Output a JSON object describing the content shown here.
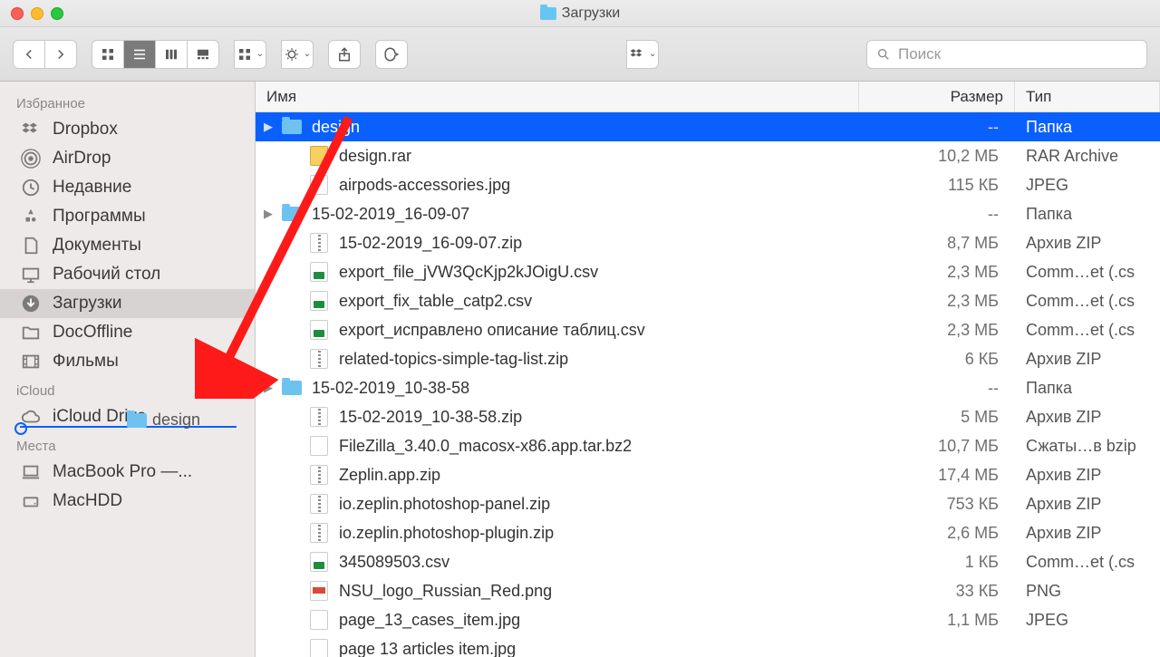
{
  "window": {
    "title": "Загрузки"
  },
  "toolbar": {
    "search_placeholder": "Поиск"
  },
  "sidebar": {
    "sections": [
      {
        "title": "Избранное",
        "items": [
          {
            "icon": "dropbox",
            "label": "Dropbox"
          },
          {
            "icon": "airdrop",
            "label": "AirDrop"
          },
          {
            "icon": "recent",
            "label": "Недавние"
          },
          {
            "icon": "apps",
            "label": "Программы"
          },
          {
            "icon": "documents",
            "label": "Документы"
          },
          {
            "icon": "desktop",
            "label": "Рабочий стол"
          },
          {
            "icon": "downloads",
            "label": "Загрузки",
            "active": true
          },
          {
            "icon": "folder",
            "label": "DocOffline"
          },
          {
            "icon": "movies",
            "label": "Фильмы"
          }
        ]
      },
      {
        "title": "iCloud",
        "items": [
          {
            "icon": "icloud",
            "label": "iCloud Drive"
          }
        ]
      },
      {
        "title": "Места",
        "items": [
          {
            "icon": "laptop",
            "label": "MacBook Pro —..."
          },
          {
            "icon": "disk",
            "label": "MacHDD"
          }
        ]
      }
    ],
    "drag_label": "design"
  },
  "columns": {
    "name": "Имя",
    "size": "Размер",
    "type": "Тип"
  },
  "files": [
    {
      "expand": "▶",
      "icon": "folder",
      "name": "design",
      "size": "--",
      "type": "Папка",
      "selected": true
    },
    {
      "indent": 1,
      "icon": "rar",
      "name": "design.rar",
      "size": "10,2 МБ",
      "type": "RAR Archive"
    },
    {
      "indent": 1,
      "icon": "jpg",
      "name": "airpods-accessories.jpg",
      "size": "115 КБ",
      "type": "JPEG"
    },
    {
      "expand": "▶",
      "icon": "folder",
      "name": "15-02-2019_16-09-07",
      "size": "--",
      "type": "Папка"
    },
    {
      "indent": 1,
      "icon": "zip",
      "name": "15-02-2019_16-09-07.zip",
      "size": "8,7 МБ",
      "type": "Архив ZIP"
    },
    {
      "indent": 1,
      "icon": "csv",
      "name": "export_file_jVW3QcKjp2kJOigU.csv",
      "size": "2,3 МБ",
      "type": "Comm…et (.cs"
    },
    {
      "indent": 1,
      "icon": "csv",
      "name": "export_fix_table_catp2.csv",
      "size": "2,3 МБ",
      "type": "Comm…et (.cs"
    },
    {
      "indent": 1,
      "icon": "csv",
      "name": "export_исправлено описание таблиц.csv",
      "size": "2,3 МБ",
      "type": "Comm…et (.cs"
    },
    {
      "indent": 1,
      "icon": "zip",
      "name": "related-topics-simple-tag-list.zip",
      "size": "6 КБ",
      "type": "Архив ZIP"
    },
    {
      "expand": "▶",
      "icon": "folder",
      "name": "15-02-2019_10-38-58",
      "size": "--",
      "type": "Папка"
    },
    {
      "indent": 1,
      "icon": "zip",
      "name": "15-02-2019_10-38-58.zip",
      "size": "5 МБ",
      "type": "Архив ZIP"
    },
    {
      "indent": 1,
      "icon": "bz2",
      "name": "FileZilla_3.40.0_macosx-x86.app.tar.bz2",
      "size": "10,7 МБ",
      "type": "Сжаты…в bzip"
    },
    {
      "indent": 1,
      "icon": "zip",
      "name": "Zeplin.app.zip",
      "size": "17,4 МБ",
      "type": "Архив ZIP"
    },
    {
      "indent": 1,
      "icon": "zip",
      "name": "io.zeplin.photoshop-panel.zip",
      "size": "753 КБ",
      "type": "Архив ZIP"
    },
    {
      "indent": 1,
      "icon": "zip",
      "name": "io.zeplin.photoshop-plugin.zip",
      "size": "2,6 МБ",
      "type": "Архив ZIP"
    },
    {
      "indent": 1,
      "icon": "csv",
      "name": "345089503.csv",
      "size": "1 КБ",
      "type": "Comm…et (.cs"
    },
    {
      "indent": 1,
      "icon": "png",
      "name": "NSU_logo_Russian_Red.png",
      "size": "33 КБ",
      "type": "PNG"
    },
    {
      "indent": 1,
      "icon": "jpg",
      "name": "page_13_cases_item.jpg",
      "size": "1,1 МБ",
      "type": "JPEG"
    },
    {
      "indent": 1,
      "icon": "jpg",
      "name": "page 13 articles item.jpg",
      "size": "",
      "type": ""
    }
  ]
}
